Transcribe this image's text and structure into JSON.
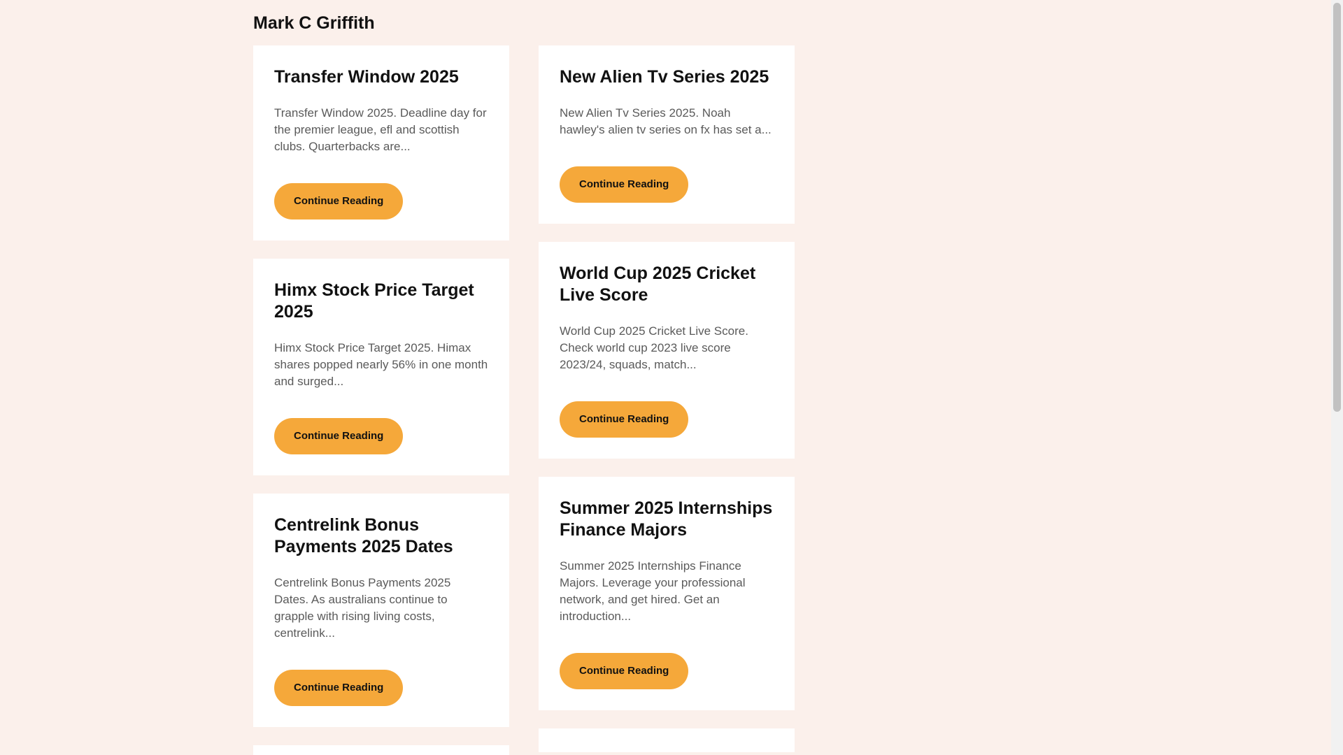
{
  "site": {
    "title": "Mark C Griffith"
  },
  "posts_left": [
    {
      "title": "Transfer Window 2025",
      "excerpt": "Transfer Window 2025. Deadline day for the premier league, efl and scottish clubs. Quarterbacks are...",
      "button": "Continue Reading"
    },
    {
      "title": "Himx Stock Price Target 2025",
      "excerpt": "Himx Stock Price Target 2025. Himax shares popped nearly 56% in one month and surged...",
      "button": "Continue Reading"
    },
    {
      "title": "Centrelink Bonus Payments 2025 Dates",
      "excerpt": "Centrelink Bonus Payments 2025 Dates. As australians continue to grapple with rising living costs, centrelink...",
      "button": "Continue Reading"
    }
  ],
  "posts_right": [
    {
      "title": "New Alien Tv Series 2025",
      "excerpt": "New Alien Tv Series 2025. Noah hawley's alien tv series on fx has set a...",
      "button": "Continue Reading"
    },
    {
      "title": "World Cup 2025 Cricket Live Score",
      "excerpt": "World Cup 2025 Cricket Live Score. Check world cup 2023 live score 2023/24, squads, match...",
      "button": "Continue Reading"
    },
    {
      "title": "Summer 2025 Internships Finance Majors",
      "excerpt": "Summer 2025 Internships Finance Majors. Leverage your professional network, and get hired. Get an introduction...",
      "button": "Continue Reading"
    }
  ],
  "colors": {
    "background": "#fbf0eb",
    "card": "#ffffff",
    "accent": "#f5a83a"
  }
}
